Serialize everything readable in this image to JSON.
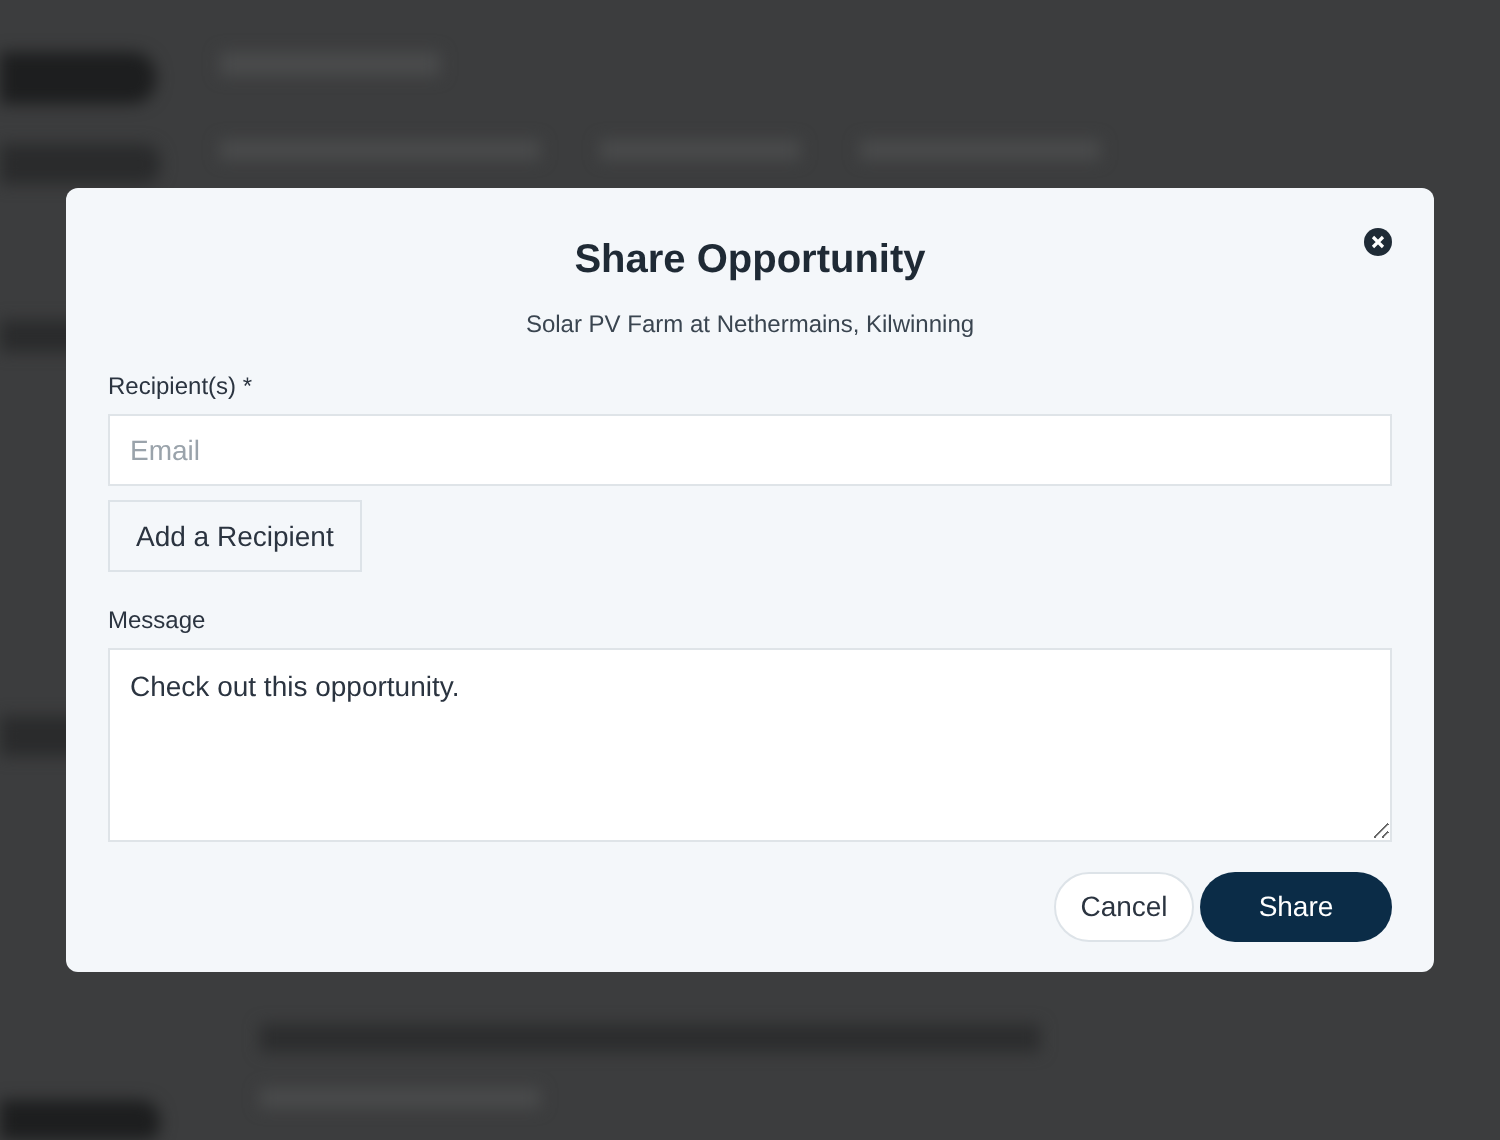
{
  "dialog": {
    "title": "Share Opportunity",
    "subtitle": "Solar PV Farm at Nethermains, Kilwinning",
    "recipients": {
      "label": "Recipient(s) *",
      "placeholder": "Email"
    },
    "add_button": "Add a Recipient",
    "message": {
      "label": "Message",
      "value": "Check out this opportunity."
    },
    "buttons": [
      {
        "label": "Cancel",
        "kind": "secondary"
      },
      {
        "label": "Share",
        "kind": "primary"
      }
    ]
  }
}
